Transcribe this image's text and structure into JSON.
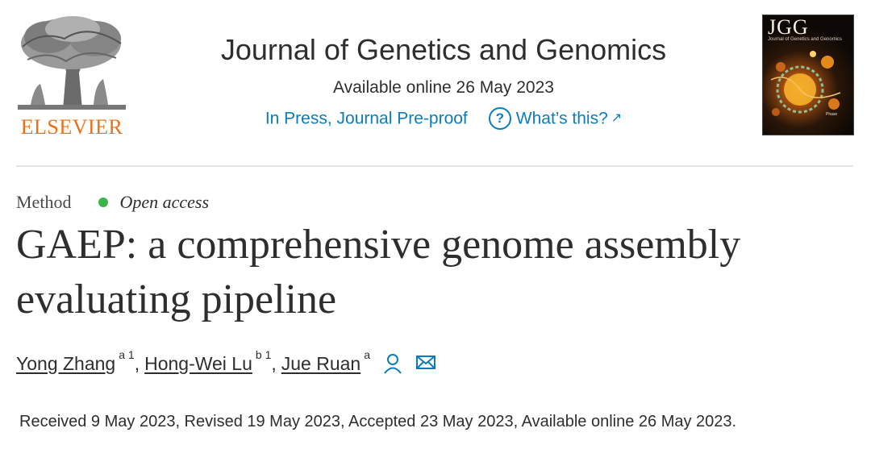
{
  "publisher": {
    "name": "ELSEVIER",
    "logo_icon": "elsevier-tree-icon"
  },
  "journal": {
    "title": "Journal of Genetics and Genomics",
    "available_online": "Available online 26 May 2023",
    "status_link": "In Press, Journal Pre-proof",
    "help_link": "What’s this?",
    "help_icon": "question-circle-icon",
    "external_icon": "external-link-icon"
  },
  "cover": {
    "title": "JGG",
    "subtitle": "Journal of Genetics and Genomics"
  },
  "article": {
    "type": "Method",
    "access": "Open access",
    "title": "GAEP: a comprehensive genome assembly evaluating pipeline",
    "authors": [
      {
        "name": "Yong Zhang",
        "sup": "a 1"
      },
      {
        "name": "Hong-Wei Lu",
        "sup": "b 1"
      },
      {
        "name": "Jue Ruan",
        "sup": "a"
      }
    ],
    "author_icons": [
      "person-icon",
      "mail-icon"
    ],
    "dates": "Received 9 May 2023, Revised 19 May 2023, Accepted 23 May 2023, Available online 26 May 2023."
  },
  "colors": {
    "link": "#0c7dbb",
    "publisher": "#e9711c",
    "open_access": "#3bb54a"
  }
}
